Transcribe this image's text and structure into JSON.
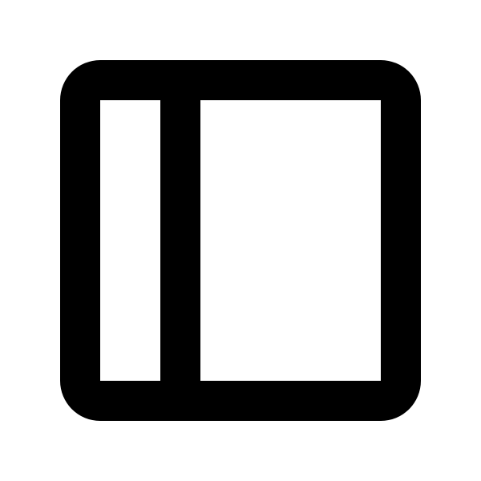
{
  "icon": {
    "name": "sidebar-panel-left-icon",
    "color": "#000000",
    "background": "#ffffff"
  }
}
